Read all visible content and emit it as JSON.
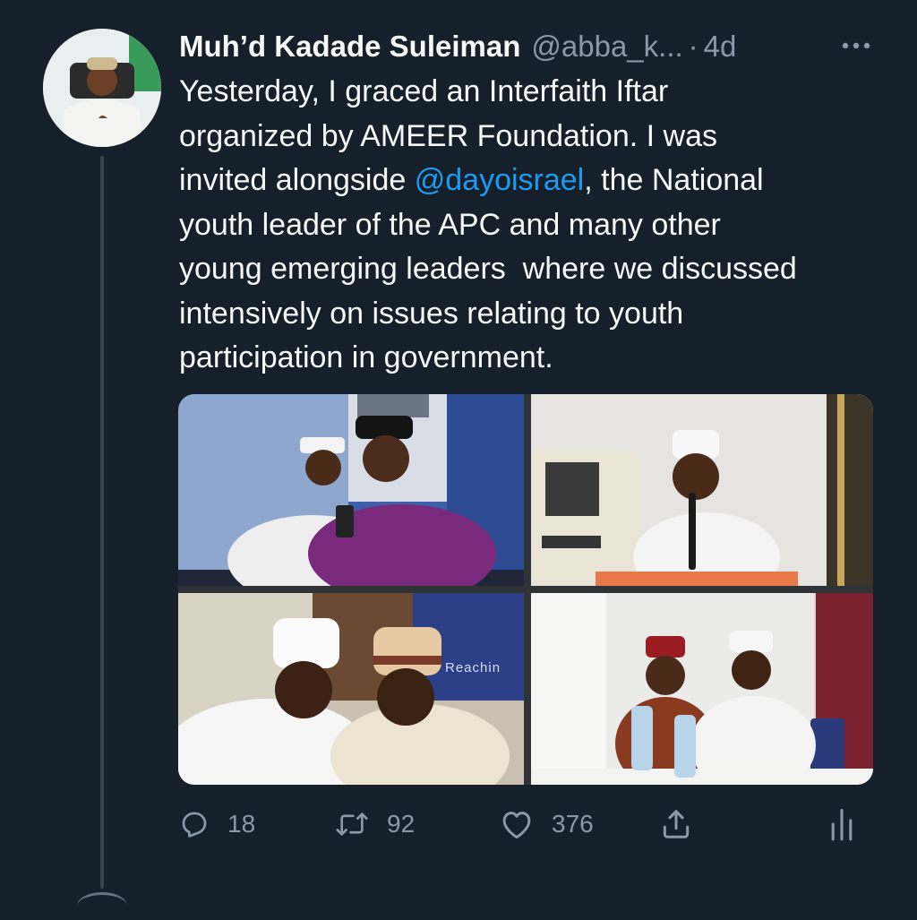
{
  "tweet": {
    "author_name": "Muh’d Kadade Suleiman",
    "handle": "@abba_k...",
    "separator": "·",
    "time": "4d",
    "text_part1": "Yesterday, I graced an Interfaith Iftar\norganized by AMEER Foundation. I was\ninvited alongside ",
    "mention": "@dayoisrael",
    "text_part2": ", the National\nyouth leader of the APC and many other\nyoung emerging leaders  where we discussed\nintensively on issues relating to youth\nparticipation in government."
  },
  "media": {
    "photo3_banner_text": "Reachin"
  },
  "actions": {
    "reply_count": "18",
    "retweet_count": "92",
    "like_count": "376"
  },
  "icons": {
    "more": "more-dots-icon",
    "reply": "reply-icon",
    "retweet": "retweet-icon",
    "like": "heart-icon",
    "share": "share-icon",
    "analytics": "analytics-icon"
  },
  "colors": {
    "background": "#15202b",
    "text": "#f7f9f9",
    "secondary": "#8b98a5",
    "link": "#1d9bf0"
  }
}
